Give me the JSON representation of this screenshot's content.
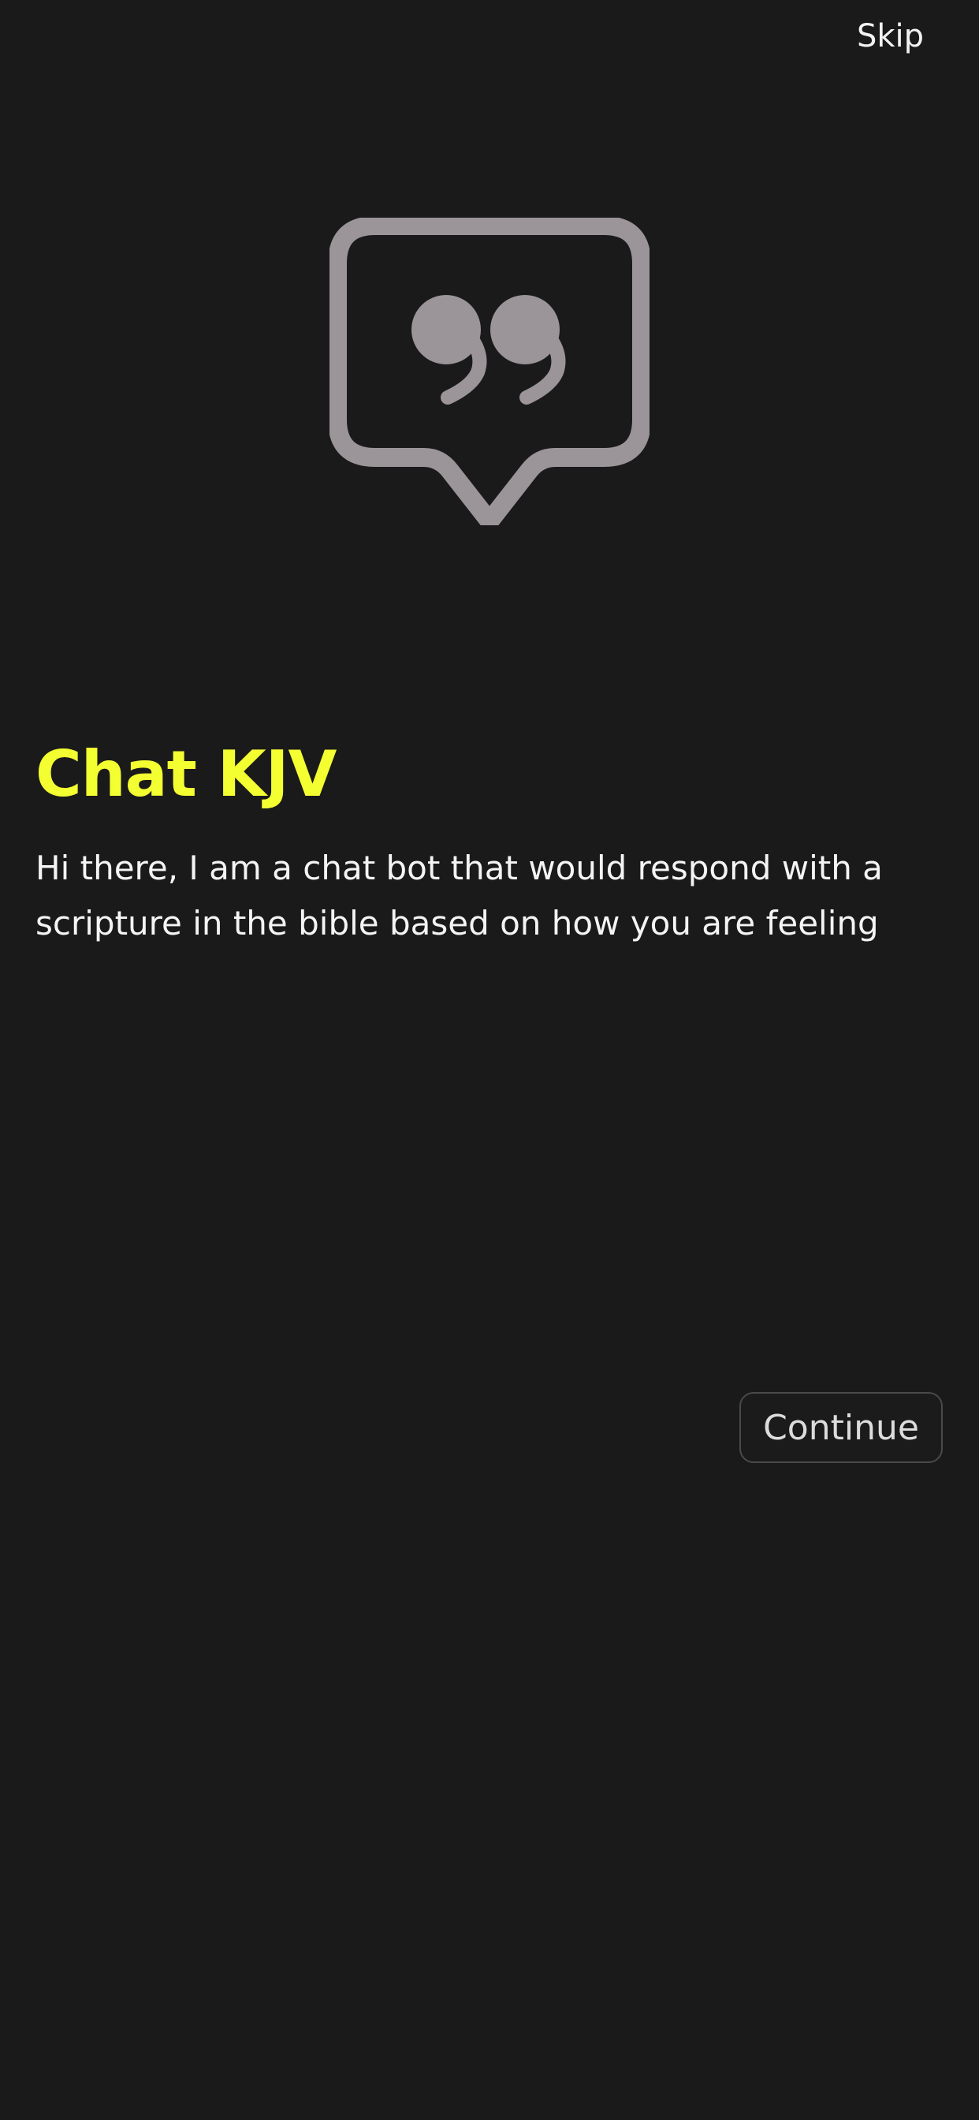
{
  "header": {
    "skip_label": "Skip"
  },
  "hero": {
    "icon": "quote-chat-bubble-icon",
    "icon_color": "#9b9599"
  },
  "content": {
    "title": "Chat KJV",
    "title_color": "#f4ff31",
    "description": "Hi there, I am a chat bot that would respond with a scripture in the bible based on how you are feeling"
  },
  "actions": {
    "continue_label": "Continue"
  },
  "colors": {
    "background": "#1a1a1a",
    "text": "#f4f4f4",
    "button_border": "#4a4a4a"
  }
}
